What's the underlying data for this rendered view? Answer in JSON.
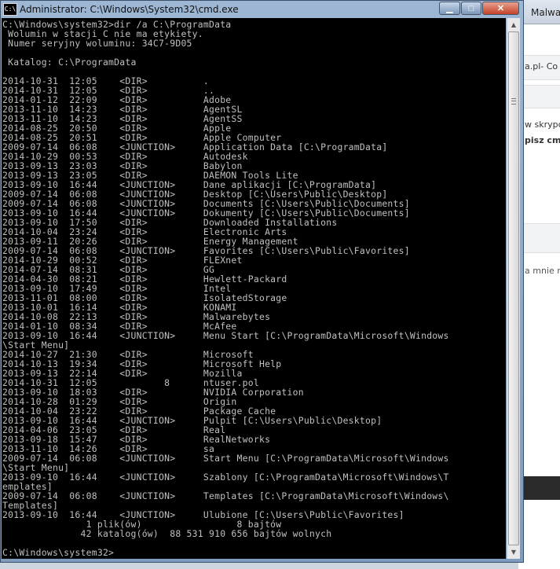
{
  "window": {
    "title": "Administrator: C:\\Windows\\System32\\cmd.exe",
    "icon": "cmd-icon",
    "minimize_icon": "minimize-icon",
    "maximize_icon": "maximize-icon",
    "close_icon": "close-icon",
    "min_glyph": "▁",
    "max_glyph": "□",
    "close_glyph": "✕"
  },
  "background": {
    "tab_label": "Malwar",
    "snippet_1": "a.pl- Co",
    "snippet_2": "w skrypc",
    "snippet_3": "pisz cmd",
    "snippet_4": "a mnie r"
  },
  "console": {
    "prompt_path": "C:\\Windows\\system32>",
    "command": "dir /a C:\\ProgramData",
    "header": [
      " Wolumin w stacji C nie ma etykiety.",
      " Numer seryjny woluminu: 34C7-9D05",
      "",
      " Katalog: C:\\ProgramData",
      ""
    ],
    "entries": [
      [
        "2014-10-31",
        "12:05",
        "<DIR>",
        "",
        "."
      ],
      [
        "2014-10-31",
        "12:05",
        "<DIR>",
        "",
        ".."
      ],
      [
        "2014-01-12",
        "22:09",
        "<DIR>",
        "",
        "Adobe"
      ],
      [
        "2013-11-10",
        "14:23",
        "<DIR>",
        "",
        "AgentSL"
      ],
      [
        "2013-11-10",
        "14:23",
        "<DIR>",
        "",
        "AgentSS"
      ],
      [
        "2014-08-25",
        "20:50",
        "<DIR>",
        "",
        "Apple"
      ],
      [
        "2014-08-25",
        "20:51",
        "<DIR>",
        "",
        "Apple Computer"
      ],
      [
        "2009-07-14",
        "06:08",
        "<JUNCTION>",
        "",
        "Application Data [C:\\ProgramData]"
      ],
      [
        "2014-10-29",
        "00:53",
        "<DIR>",
        "",
        "Autodesk"
      ],
      [
        "2013-09-13",
        "23:03",
        "<DIR>",
        "",
        "Babylon"
      ],
      [
        "2013-09-13",
        "23:05",
        "<DIR>",
        "",
        "DAEMON Tools Lite"
      ],
      [
        "2013-09-10",
        "16:44",
        "<JUNCTION>",
        "",
        "Dane aplikacji [C:\\ProgramData]"
      ],
      [
        "2009-07-14",
        "06:08",
        "<JUNCTION>",
        "",
        "Desktop [C:\\Users\\Public\\Desktop]"
      ],
      [
        "2009-07-14",
        "06:08",
        "<JUNCTION>",
        "",
        "Documents [C:\\Users\\Public\\Documents]"
      ],
      [
        "2013-09-10",
        "16:44",
        "<JUNCTION>",
        "",
        "Dokumenty [C:\\Users\\Public\\Documents]"
      ],
      [
        "2013-09-10",
        "17:50",
        "<DIR>",
        "",
        "Downloaded Installations"
      ],
      [
        "2014-10-04",
        "23:24",
        "<DIR>",
        "",
        "Electronic Arts"
      ],
      [
        "2013-09-11",
        "20:26",
        "<DIR>",
        "",
        "Energy Management"
      ],
      [
        "2009-07-14",
        "06:08",
        "<JUNCTION>",
        "",
        "Favorites [C:\\Users\\Public\\Favorites]"
      ],
      [
        "2014-10-29",
        "00:52",
        "<DIR>",
        "",
        "FLEXnet"
      ],
      [
        "2014-07-14",
        "08:31",
        "<DIR>",
        "",
        "GG"
      ],
      [
        "2014-04-30",
        "08:21",
        "<DIR>",
        "",
        "Hewlett-Packard"
      ],
      [
        "2013-09-10",
        "17:49",
        "<DIR>",
        "",
        "Intel"
      ],
      [
        "2013-11-01",
        "08:00",
        "<DIR>",
        "",
        "IsolatedStorage"
      ],
      [
        "2013-10-01",
        "16:14",
        "<DIR>",
        "",
        "KONAMI"
      ],
      [
        "2014-10-08",
        "22:13",
        "<DIR>",
        "",
        "Malwarebytes"
      ],
      [
        "2014-01-10",
        "08:34",
        "<DIR>",
        "",
        "McAfee"
      ],
      [
        "2013-09-10",
        "16:44",
        "<JUNCTION>",
        "",
        "Menu Start [C:\\ProgramData\\Microsoft\\Windows\\Start Menu]"
      ],
      [
        "2014-10-27",
        "21:30",
        "<DIR>",
        "",
        "Microsoft"
      ],
      [
        "2014-10-13",
        "19:34",
        "<DIR>",
        "",
        "Microsoft Help"
      ],
      [
        "2013-09-13",
        "22:14",
        "<DIR>",
        "",
        "Mozilla"
      ],
      [
        "2014-10-31",
        "12:05",
        "",
        "8",
        "ntuser.pol"
      ],
      [
        "2013-09-10",
        "18:03",
        "<DIR>",
        "",
        "NVIDIA Corporation"
      ],
      [
        "2014-10-28",
        "01:29",
        "<DIR>",
        "",
        "Origin"
      ],
      [
        "2014-10-04",
        "23:22",
        "<DIR>",
        "",
        "Package Cache"
      ],
      [
        "2013-09-10",
        "16:44",
        "<JUNCTION>",
        "",
        "Pulpit [C:\\Users\\Public\\Desktop]"
      ],
      [
        "2014-04-06",
        "23:05",
        "<DIR>",
        "",
        "Real"
      ],
      [
        "2013-09-18",
        "15:47",
        "<DIR>",
        "",
        "RealNetworks"
      ],
      [
        "2013-11-10",
        "14:26",
        "<DIR>",
        "",
        "sa"
      ],
      [
        "2009-07-14",
        "06:08",
        "<JUNCTION>",
        "",
        "Start Menu [C:\\ProgramData\\Microsoft\\Windows\\Start Menu]"
      ],
      [
        "2013-09-10",
        "16:44",
        "<JUNCTION>",
        "",
        "Szablony [C:\\ProgramData\\Microsoft\\Windows\\Templates]"
      ],
      [
        "2009-07-14",
        "06:08",
        "<JUNCTION>",
        "",
        "Templates [C:\\ProgramData\\Microsoft\\Windows\\Templates]"
      ],
      [
        "2013-09-10",
        "16:44",
        "<JUNCTION>",
        "",
        "Ulubione [C:\\Users\\Public\\Favorites]"
      ]
    ],
    "summary": [
      "               1 plik(ów)                 8 bajtów",
      "              42 katalog(ów)  88 531 910 656 bajtów wolnych",
      ""
    ],
    "final_prompt": "C:\\Windows\\system32>"
  },
  "scrollbar": {
    "up_icon": "scroll-up-icon",
    "down_icon": "scroll-down-icon",
    "up_glyph": "▲",
    "down_glyph": "▼"
  }
}
